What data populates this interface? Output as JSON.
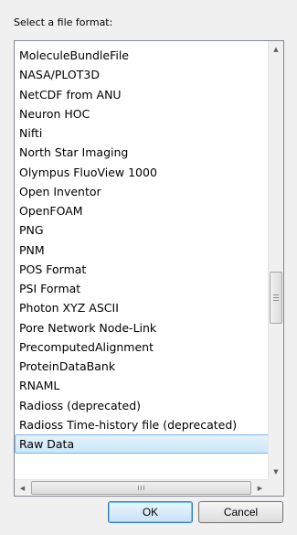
{
  "dialog": {
    "prompt": "Select a file format:",
    "formats": [
      "MoleculeBundleFile",
      "NASA/PLOT3D",
      "NetCDF from ANU",
      "Neuron HOC",
      "Nifti",
      "North Star Imaging",
      "Olympus FluoView 1000",
      "Open Inventor",
      "OpenFOAM",
      "PNG",
      "PNM",
      "POS Format",
      "PSI Format",
      "Photon XYZ ASCII",
      "Pore Network Node-Link",
      "PrecomputedAlignment",
      "ProteinDataBank",
      "RNAML",
      "Radioss (deprecated)",
      "Radioss Time-history file (deprecated)",
      "Raw Data"
    ],
    "selected": "Raw Data",
    "ok_label": "OK",
    "cancel_label": "Cancel"
  },
  "icons": {
    "scroll_up": "triangle-up-icon",
    "scroll_down": "triangle-down-icon",
    "scroll_left": "triangle-left-icon",
    "scroll_right": "triangle-right-icon"
  },
  "colors": {
    "selection_border": "#7eb4ea",
    "selection_fill": "#cbe6f8",
    "default_button_border": "#3c7fb1"
  }
}
